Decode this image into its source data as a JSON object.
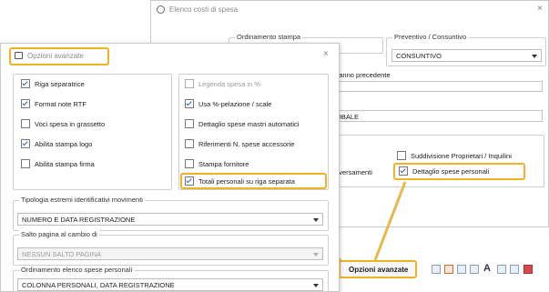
{
  "bg_window": {
    "title": "Elenco costi di spesa",
    "close": "×",
    "ordinamento_label": "Ordinamento stampa",
    "preventivo_label": "Preventivo / Consuntivo",
    "preventivo_value": "CONSUNTIVO",
    "anno_prec_text": "a anno precedente",
    "globale_text": "OBALE",
    "versamenti_text": "e versamenti",
    "suddivisione_label": "Suddivisione Proprietari / Inquilini",
    "dettaglio_label": "Dettaglio spese personali"
  },
  "dialog": {
    "title": "Opzioni avanzate",
    "close": "×",
    "left_checks": [
      {
        "label": "Riga separatrice",
        "checked": true
      },
      {
        "label": "Format note RTF",
        "checked": true
      },
      {
        "label": "Voci spesa in grassetto",
        "checked": false
      },
      {
        "label": "Abilita stampa logo",
        "checked": true
      },
      {
        "label": "Abilita stampa firma",
        "checked": false
      }
    ],
    "right_checks": [
      {
        "label": "Legenda spesa in %",
        "checked": false,
        "disabled": true
      },
      {
        "label": "Usa %-pelazione / scale",
        "checked": true
      },
      {
        "label": "Dettaglio spese mastri automatici",
        "checked": false
      },
      {
        "label": "Riferimenti N. spese accessorie",
        "checked": false
      },
      {
        "label": "Stampa fornitore",
        "checked": false
      },
      {
        "label": "Totali personali su riga separata",
        "checked": true
      }
    ],
    "tipologia_label": "Tipologia estremi identificativi movimenti",
    "tipologia_value": "NUMERO E DATA REGISTRAZIONE",
    "salto_label": "Salto pagina al cambio di",
    "salto_value": "NESSUN SALTO PAGINA",
    "ordinamento_label": "Ordinamento elenco spese personali",
    "ordinamento_value": "COLONNA PERSONALI, DATA REGISTRAZIONE"
  },
  "toolbar": {
    "opzioni_button": "Opzioni avanzate"
  },
  "colors": {
    "highlight": "#f0b323",
    "arrow": "#e8b84a"
  }
}
